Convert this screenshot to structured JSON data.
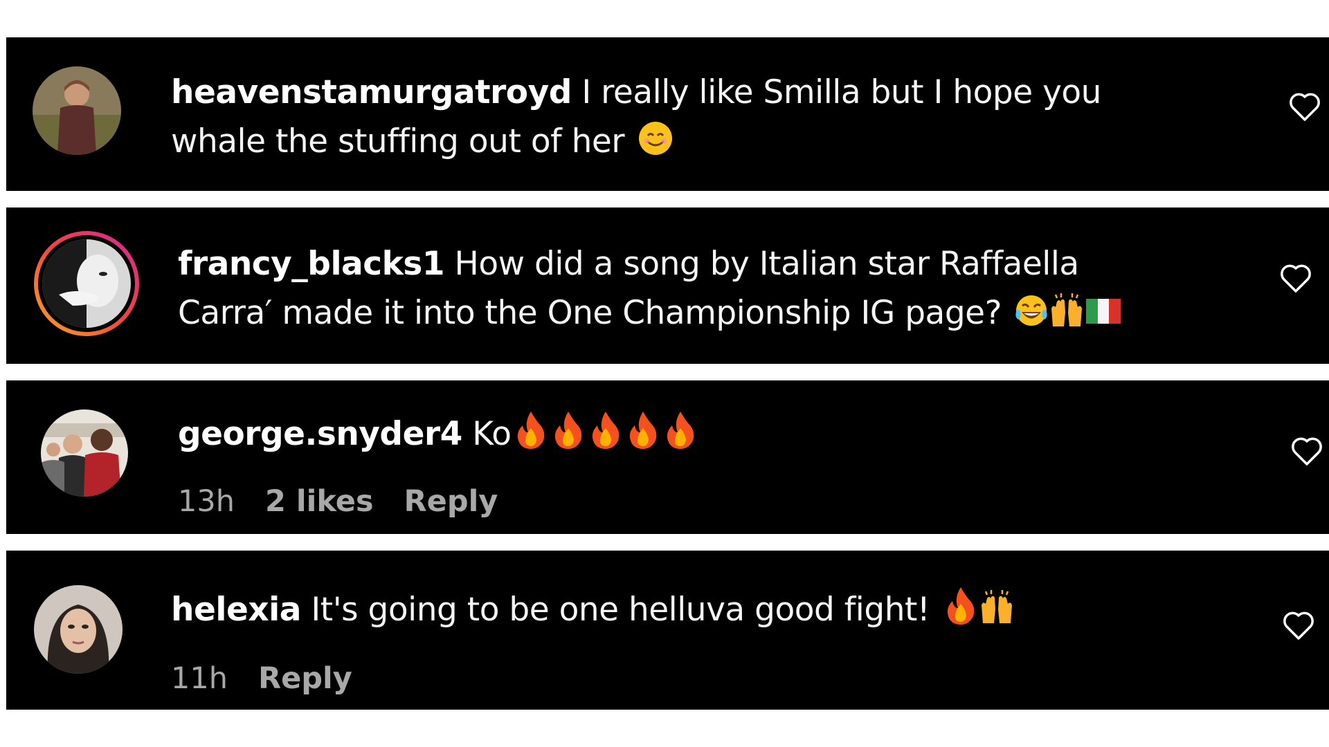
{
  "comments": [
    {
      "username": "heavenstamurgatroyd",
      "line1": "I really like Smilla but I hope you",
      "line2": "whale the stuffing out of her",
      "emojis": [
        "smiling-face"
      ]
    },
    {
      "username": "francy_blacks1",
      "line1": "How did a song by Italian star Raffaella",
      "line2": "Carra′ made it into the One Championship IG page?",
      "emojis": [
        "tears-of-joy",
        "raising-hands",
        "italy-flag"
      ]
    },
    {
      "username": "george.snyder4",
      "text": "Ko",
      "emojis": [
        "fire",
        "fire",
        "fire",
        "fire",
        "fire"
      ],
      "time": "13h",
      "likes": "2 likes",
      "reply": "Reply"
    },
    {
      "username": "helexia",
      "text": "It's going to be one helluva good fight!",
      "emojis": [
        "fire",
        "raising-hands"
      ],
      "time": "11h",
      "reply": "Reply"
    }
  ],
  "colors": {
    "card_bg": "#000000",
    "page_bg": "#ffffff",
    "meta_text": "#a8a8a8",
    "story_ring_start": "#f9a825",
    "story_ring_end": "#d6249f"
  },
  "icons": {
    "like": "heart-outline-icon"
  }
}
